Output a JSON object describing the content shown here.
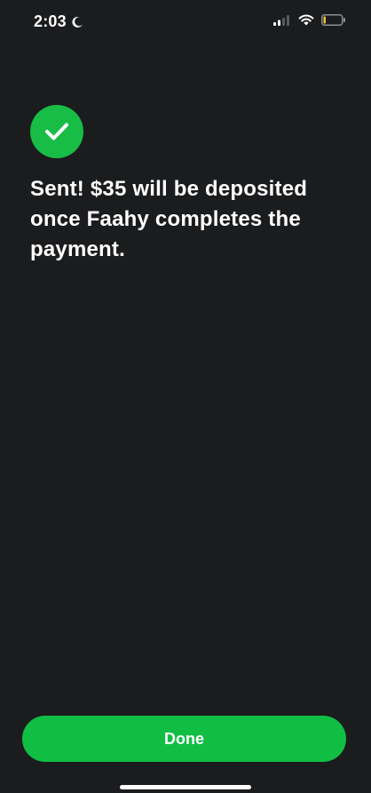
{
  "status_bar": {
    "time": "2:03",
    "icons": [
      "moon-icon",
      "signal-icon",
      "wifi-icon",
      "battery-icon"
    ]
  },
  "success_icon": "checkmark-icon",
  "message": "Sent! $35 will be deposited once Faahy completes the payment.",
  "done_button": {
    "label": "Done"
  },
  "colors": {
    "background": "#1b1c1e",
    "accent": "#10be44",
    "text": "#ffffff"
  }
}
